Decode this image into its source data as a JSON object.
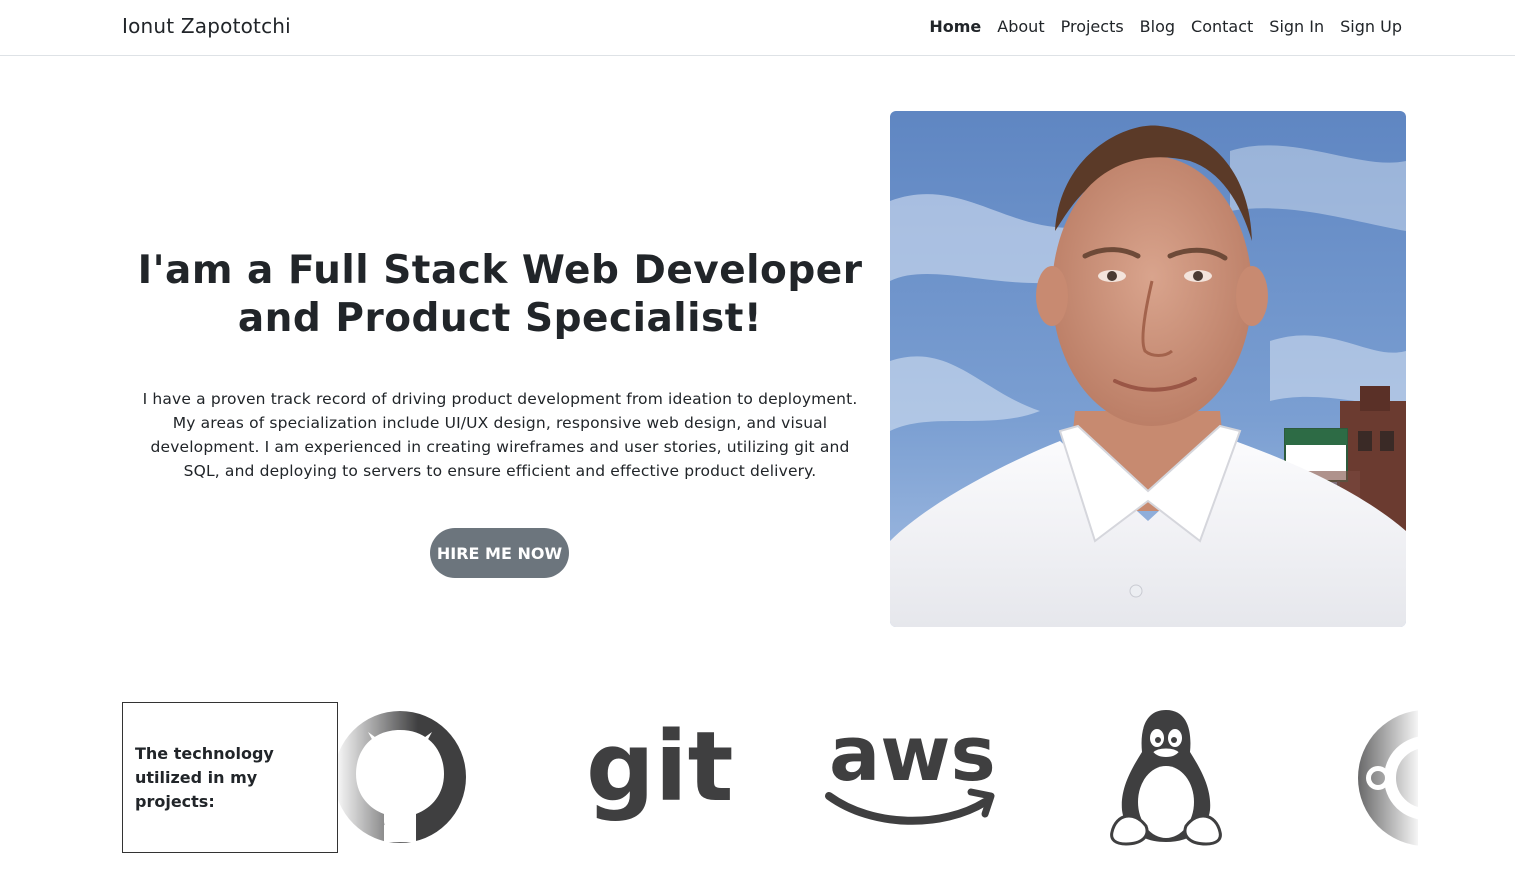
{
  "brand": "Ionut Zapototchi",
  "nav": {
    "items": [
      {
        "label": "Home",
        "active": true
      },
      {
        "label": "About"
      },
      {
        "label": "Projects"
      },
      {
        "label": "Blog"
      },
      {
        "label": "Contact"
      },
      {
        "label": "Sign In"
      },
      {
        "label": "Sign Up"
      }
    ]
  },
  "hero": {
    "headline_line1": "I'am a Full Stack Web Developer",
    "headline_line2": "and Product Specialist!",
    "description": "I have a proven track record of driving product development from ideation to deployment. My areas of specialization include UI/UX design, responsive web design, and visual development. I am experienced in creating wireframes and user stories, utilizing git and SQL, and deploying to servers to ensure efficient and effective product delivery.",
    "cta_label": "HIRE ME NOW"
  },
  "tech": {
    "label": "The technology utilized in my projects:",
    "logos": [
      {
        "icon": "github-icon"
      },
      {
        "icon": "git-icon",
        "text": "git"
      },
      {
        "icon": "aws-icon",
        "text": "aws"
      },
      {
        "icon": "linux-tux-icon"
      },
      {
        "icon": "ubuntu-icon"
      }
    ]
  },
  "colors": {
    "button": "#6c757d",
    "text": "#212529",
    "logo_gray": "#3f3f40"
  }
}
